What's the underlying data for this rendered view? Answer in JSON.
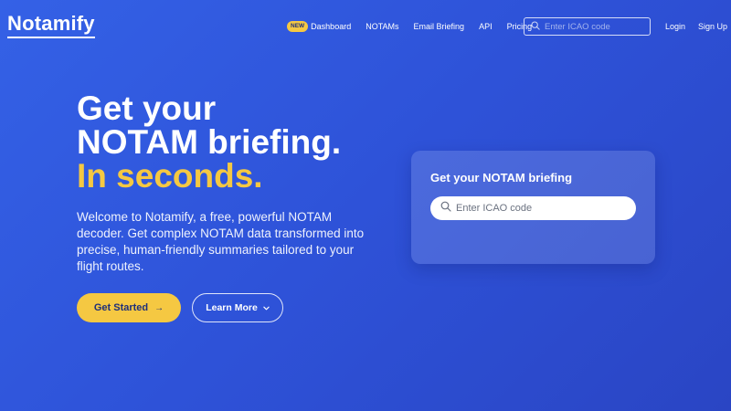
{
  "brand": {
    "logo": "Notamify"
  },
  "nav": {
    "badge": "NEW",
    "dashboard": "Dashboard",
    "notams": "NOTAMs",
    "email_briefing": "Email Briefing",
    "api": "API",
    "pricing": "Pricing",
    "search_placeholder": "Enter ICAO code",
    "login": "Login",
    "signup": "Sign Up"
  },
  "hero": {
    "title_line1": "Get your",
    "title_line2": "NOTAM briefing.",
    "title_line3": "In seconds.",
    "description": "Welcome to Notamify, a free, powerful NOTAM decoder. Get complex NOTAM data transformed into precise, human-friendly summaries tailored to your flight routes.",
    "primary_button": "Get Started",
    "secondary_button": "Learn More"
  },
  "card": {
    "title": "Get your NOTAM briefing",
    "search_placeholder": "Enter ICAO code"
  },
  "icons": {
    "nav_search": "search-icon",
    "card_search": "search-icon",
    "primary_arrow": "arrow-right-icon",
    "secondary_chevron": "chevron-down-icon"
  },
  "colors": {
    "background": "#3461e6",
    "accent": "#f5c842",
    "text_dark": "#1e2f7a"
  }
}
